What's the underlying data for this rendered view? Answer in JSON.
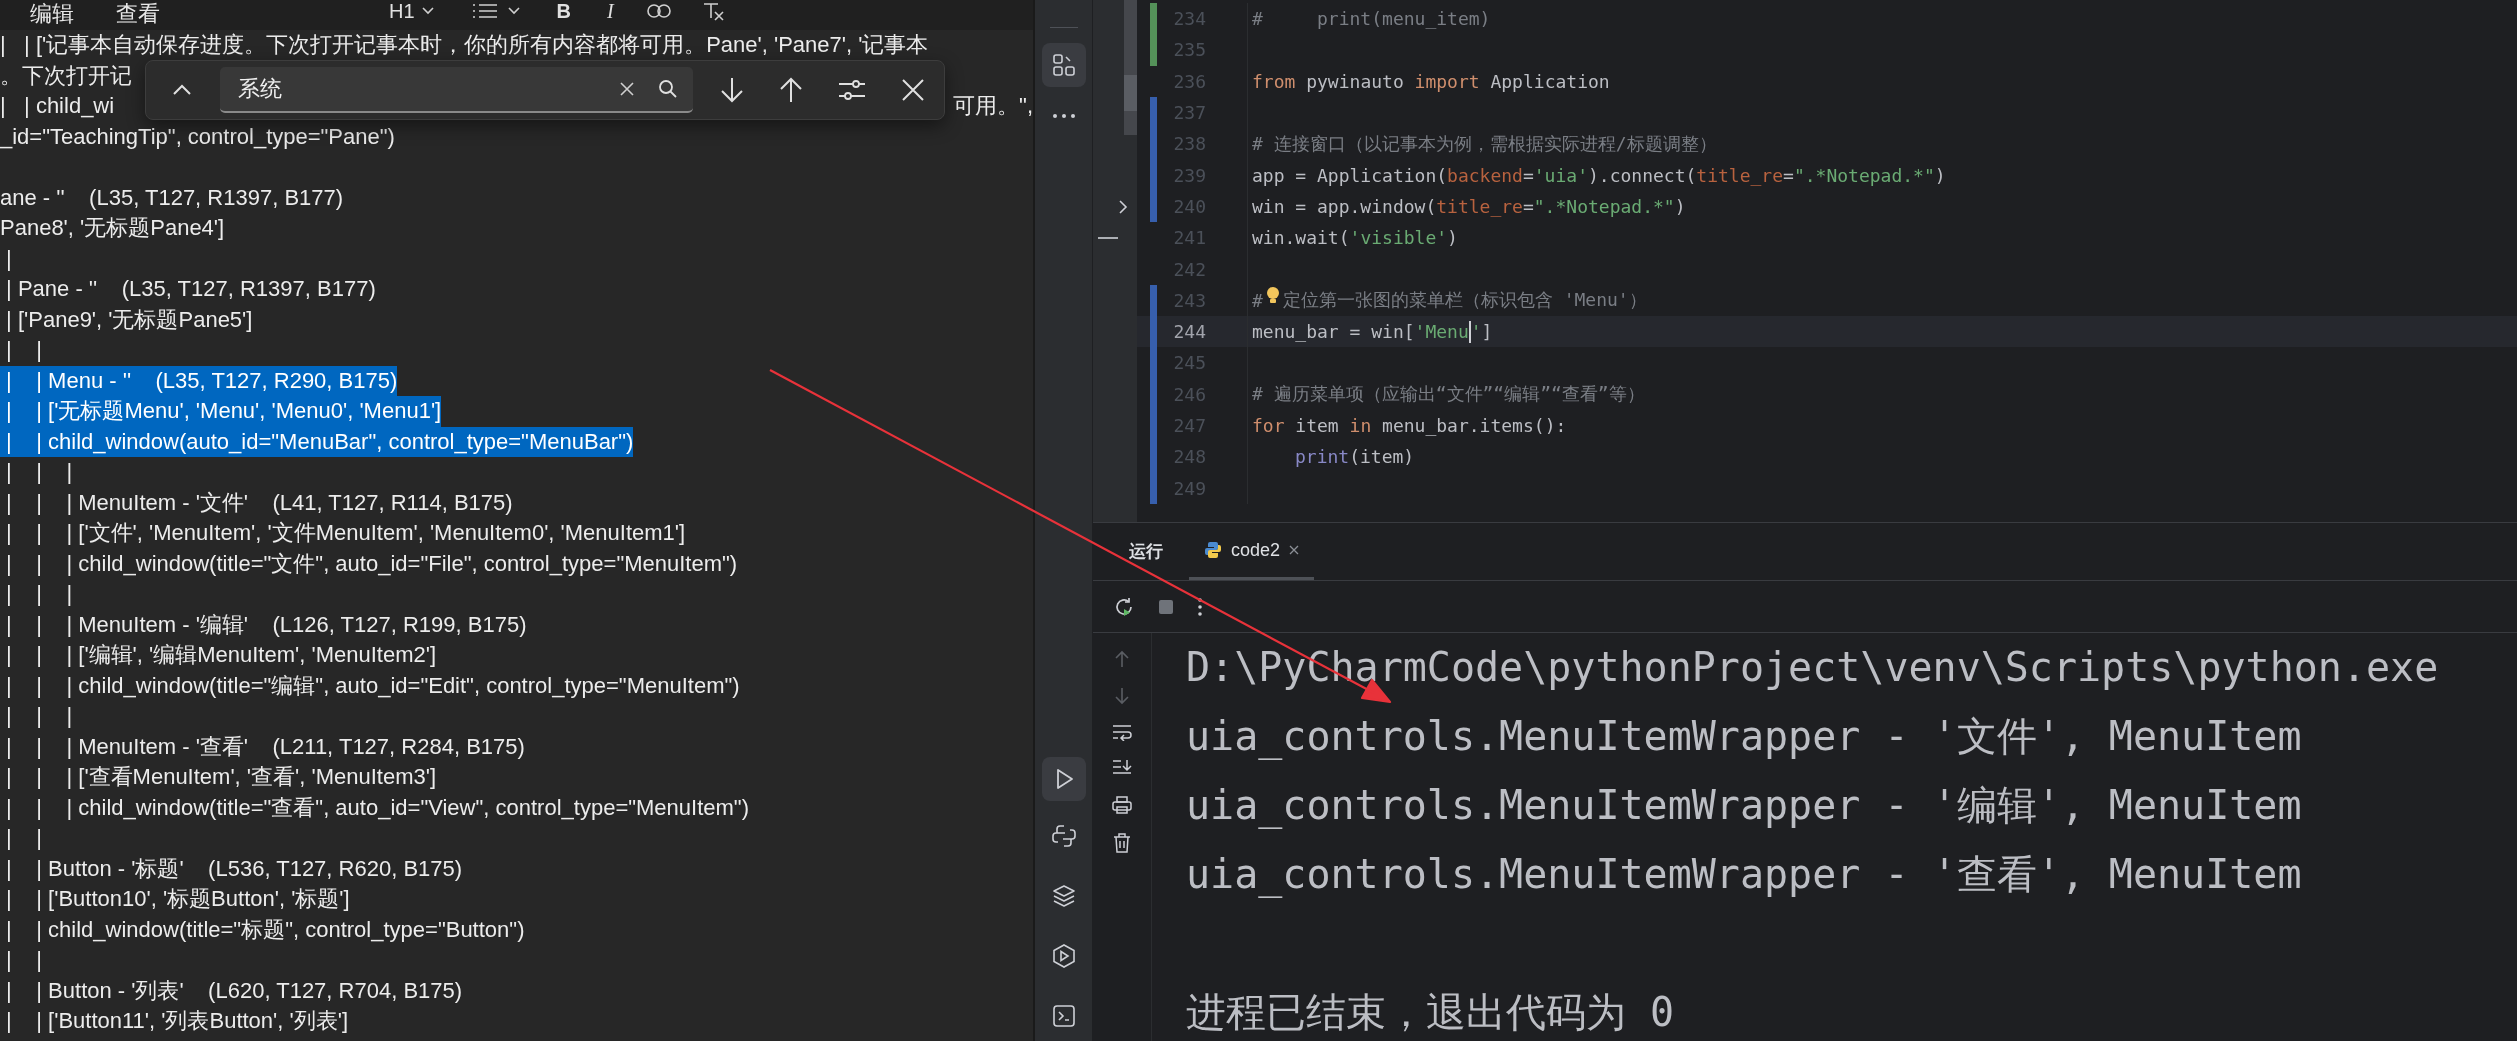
{
  "notepad": {
    "menu": [
      {
        "label": "编辑"
      },
      {
        "label": "查看"
      }
    ],
    "toolbar": [
      {
        "kind": "text",
        "label": "H1",
        "dropdown": true
      },
      {
        "kind": "list",
        "dropdown": true
      },
      {
        "kind": "bold",
        "label": "B"
      },
      {
        "kind": "italic",
        "label": "I"
      },
      {
        "kind": "link"
      },
      {
        "kind": "clear"
      }
    ],
    "find": {
      "value": "系统"
    },
    "lines": [
      {
        "text": "|   | ['记事本自动保存进度。下次打开记事本时，你的所有内容都将可用。Pane', 'Pane7', '记事本",
        "selected": false
      },
      {
        "text": "。下次打开记",
        "selected": false
      },
      {
        "text": "|   | child_wi",
        "tail": "可用。\",",
        "selected": false
      },
      {
        "text": "_id=\"TeachingTip\", control_type=\"Pane\")",
        "selected": false
      },
      {
        "text": "ane - ''    (L35, T127, R1397, B177)",
        "selected": false,
        "gap_before": true
      },
      {
        "text": "Pane8', '无标题Pane4']",
        "selected": false
      },
      {
        "text": " |",
        "selected": false
      },
      {
        "text": " | Pane - ''    (L35, T127, R1397, B177)",
        "selected": false
      },
      {
        "text": " | ['Pane9', '无标题Pane5']",
        "selected": false
      },
      {
        "text": " |    |",
        "selected": false
      },
      {
        "text": " |    | Menu - ''    (L35, T127, R290, B175)",
        "selected": true
      },
      {
        "text": " |    | ['无标题Menu', 'Menu', 'Menu0', 'Menu1']",
        "selected": true
      },
      {
        "text": " |    | child_window(auto_id=\"MenuBar\", control_type=\"MenuBar\")",
        "selected": true
      },
      {
        "text": " |    |    |",
        "selected": false
      },
      {
        "text": " |    |    | MenuItem - '文件'    (L41, T127, R114, B175)",
        "selected": false
      },
      {
        "text": " |    |    | ['文件', 'MenuItem', '文件MenuItem', 'MenuItem0', 'MenuItem1']",
        "selected": false
      },
      {
        "text": " |    |    | child_window(title=\"文件\", auto_id=\"File\", control_type=\"MenuItem\")",
        "selected": false
      },
      {
        "text": " |    |    |",
        "selected": false
      },
      {
        "text": " |    |    | MenuItem - '编辑'    (L126, T127, R199, B175)",
        "selected": false
      },
      {
        "text": " |    |    | ['编辑', '编辑MenuItem', 'MenuItem2']",
        "selected": false
      },
      {
        "text": " |    |    | child_window(title=\"编辑\", auto_id=\"Edit\", control_type=\"MenuItem\")",
        "selected": false
      },
      {
        "text": " |    |    |",
        "selected": false
      },
      {
        "text": " |    |    | MenuItem - '查看'    (L211, T127, R284, B175)",
        "selected": false
      },
      {
        "text": " |    |    | ['查看MenuItem', '查看', 'MenuItem3']",
        "selected": false
      },
      {
        "text": " |    |    | child_window(title=\"查看\", auto_id=\"View\", control_type=\"MenuItem\")",
        "selected": false
      },
      {
        "text": " |    |",
        "selected": false
      },
      {
        "text": " |    | Button - '标题'    (L536, T127, R620, B175)",
        "selected": false
      },
      {
        "text": " |    | ['Button10', '标题Button', '标题']",
        "selected": false
      },
      {
        "text": " |    | child_window(title=\"标题\", control_type=\"Button\")",
        "selected": false
      },
      {
        "text": " |    |",
        "selected": false
      },
      {
        "text": " |    | Button - '列表'    (L620, T127, R704, B175)",
        "selected": false
      },
      {
        "text": " |    | ['Button11', '列表Button', '列表']",
        "selected": false
      }
    ]
  },
  "editor": {
    "lines": [
      {
        "number": "234",
        "color": "#549159",
        "current": false,
        "tokens": [
          {
            "kind": "comment",
            "text": "#     print(menu_item)"
          }
        ]
      },
      {
        "number": "235",
        "color": "#549159",
        "current": false
      },
      {
        "number": "236",
        "current": false,
        "tokens": [
          {
            "kind": "keyword",
            "text": "from"
          },
          {
            "kind": "plain",
            "text": " pywinauto "
          },
          {
            "kind": "keyword",
            "text": "import"
          },
          {
            "kind": "plain",
            "text": " Application"
          }
        ]
      },
      {
        "number": "237",
        "color": "#375fad",
        "current": false
      },
      {
        "number": "238",
        "color": "#375fad",
        "current": false,
        "tokens": [
          {
            "kind": "comment",
            "text": "# 连接窗口（以记事本为例，需根据实际进程/标题调整）"
          }
        ]
      },
      {
        "number": "239",
        "color": "#375fad",
        "current": false,
        "tokens": [
          {
            "kind": "plain",
            "text": "app = Application("
          },
          {
            "kind": "param",
            "text": "backend"
          },
          {
            "kind": "plain",
            "text": "="
          },
          {
            "kind": "string",
            "text": "'uia'"
          },
          {
            "kind": "plain",
            "text": ").connect("
          },
          {
            "kind": "param",
            "text": "title_re"
          },
          {
            "kind": "plain",
            "text": "="
          },
          {
            "kind": "string",
            "text": "\".*Notepad.*\""
          },
          {
            "kind": "plain",
            "text": ")"
          }
        ]
      },
      {
        "number": "240",
        "color": "#375fad",
        "current": false,
        "tokens": [
          {
            "kind": "plain",
            "text": "win = app.window("
          },
          {
            "kind": "param",
            "text": "title_re"
          },
          {
            "kind": "plain",
            "text": "="
          },
          {
            "kind": "string",
            "text": "\".*Notepad.*\""
          },
          {
            "kind": "plain",
            "text": ")"
          }
        ]
      },
      {
        "number": "241",
        "current": false,
        "tokens": [
          {
            "kind": "plain",
            "text": "win.wait("
          },
          {
            "kind": "string",
            "text": "'visible'"
          },
          {
            "kind": "plain",
            "text": ")"
          }
        ]
      },
      {
        "number": "242",
        "current": false
      },
      {
        "number": "243",
        "color": "#375fad",
        "current": false,
        "tokens": [
          {
            "kind": "comment",
            "text": "#"
          },
          {
            "kind": "bulb"
          },
          {
            "kind": "comment",
            "text": "定位第一张图的菜单栏（标识包含 'Menu'）"
          }
        ]
      },
      {
        "number": "244",
        "color": "#375fad",
        "current": true,
        "tokens": [
          {
            "kind": "plain",
            "text": "menu_bar = win["
          },
          {
            "kind": "string",
            "text": "'Menu"
          },
          {
            "kind": "caret"
          },
          {
            "kind": "string",
            "text": "'"
          },
          {
            "kind": "plain",
            "text": "]"
          }
        ]
      },
      {
        "number": "245",
        "color": "#375fad",
        "current": false
      },
      {
        "number": "246",
        "color": "#375fad",
        "current": false,
        "tokens": [
          {
            "kind": "comment",
            "text": "# 遍历菜单项（应输出“文件”“编辑”“查看”等）"
          }
        ]
      },
      {
        "number": "247",
        "color": "#375fad",
        "current": false,
        "tokens": [
          {
            "kind": "keyword",
            "text": "for"
          },
          {
            "kind": "plain",
            "text": " item "
          },
          {
            "kind": "keyword",
            "text": "in"
          },
          {
            "kind": "plain",
            "text": " menu_bar.items():"
          }
        ]
      },
      {
        "number": "248",
        "color": "#375fad",
        "current": false,
        "indented": true,
        "tokens": [
          {
            "kind": "builtin",
            "text": "print"
          },
          {
            "kind": "plain",
            "text": "(item)"
          }
        ]
      },
      {
        "number": "249",
        "color": "#375fad",
        "current": false
      }
    ]
  },
  "run": {
    "title": "运行",
    "tabs": [
      {
        "label": "code2",
        "selected": true
      }
    ],
    "output": [
      "D:\\PyCharmCode\\pythonProject\\venv\\Scripts\\python.exe",
      "uia_controls.MenuItemWrapper - '文件', MenuItem",
      "uia_controls.MenuItemWrapper - '编辑', MenuItem",
      "uia_controls.MenuItemWrapper - '查看', MenuItem"
    ],
    "exit_message": "进程已结束，退出代码为 0"
  }
}
